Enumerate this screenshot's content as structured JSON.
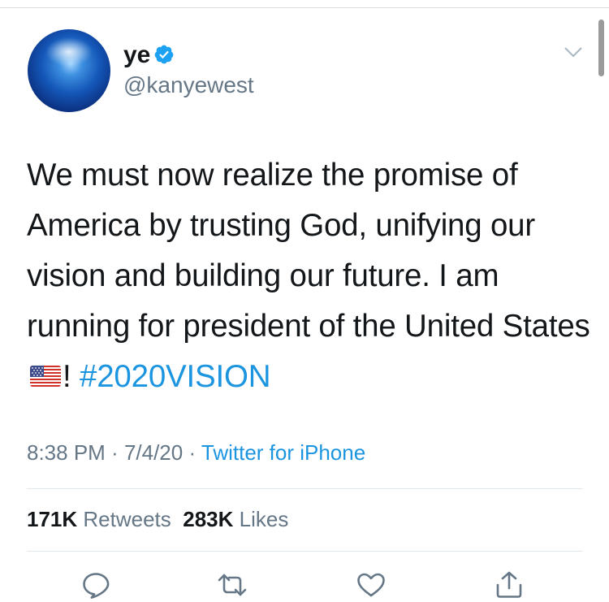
{
  "user": {
    "display_name": "ye",
    "handle": "@kanyewest",
    "verified": true
  },
  "tweet": {
    "text_main": "We must now realize the promise of America by trusting God, unifying our vision and building our future. I am running for president of the United States ",
    "text_after_flag": "! ",
    "hashtag": "#2020VISION",
    "flag_icon": "us-flag-icon"
  },
  "meta": {
    "time": "8:38 PM",
    "separator1": " · ",
    "date": "7/4/20",
    "separator2": " · ",
    "source": "Twitter for iPhone"
  },
  "stats": {
    "retweets_count": "171K",
    "retweets_label": "Retweets",
    "likes_count": "283K",
    "likes_label": "Likes"
  },
  "actions": [
    "reply-icon",
    "retweet-icon",
    "like-icon",
    "share-icon"
  ],
  "colors": {
    "link": "#1b95e0",
    "secondary_text": "#657786",
    "primary_text": "#14171a",
    "divider": "#e1e8ed"
  }
}
